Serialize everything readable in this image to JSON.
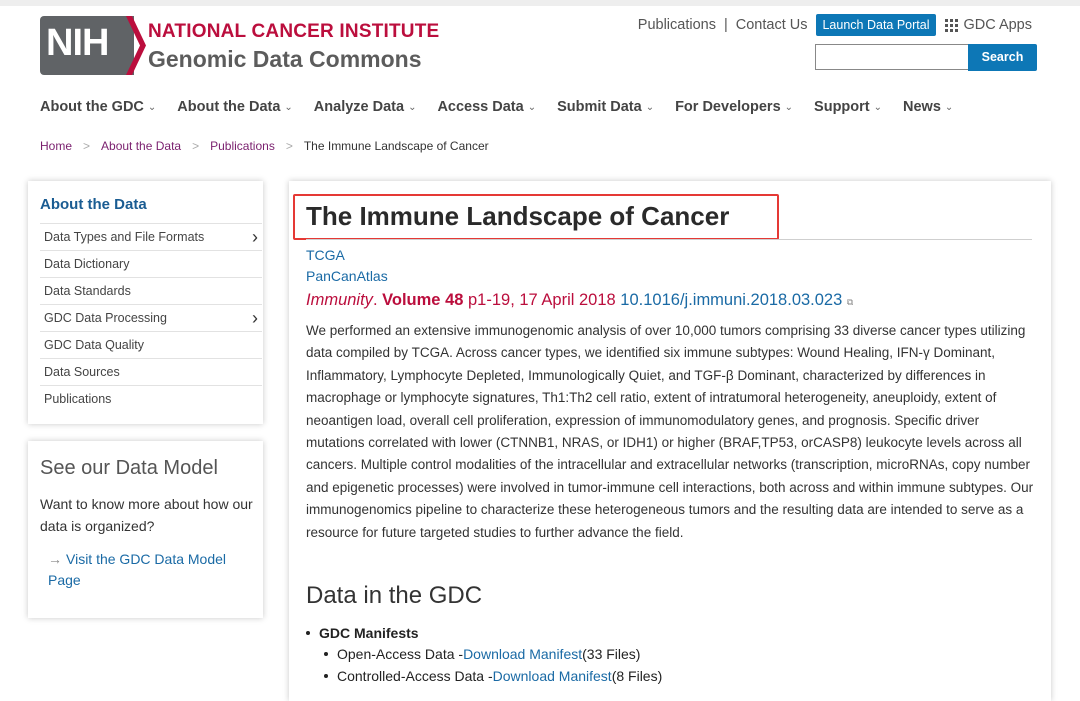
{
  "header": {
    "logo_mark": "NIH",
    "institute": "NATIONAL CANCER INSTITUTE",
    "site_name": "Genomic Data Commons",
    "util_links": [
      "Publications",
      "Contact Us"
    ],
    "util_separator": "|",
    "portal_button": "Launch Data Portal",
    "apps_label": "GDC Apps",
    "search_button": "Search",
    "search_value": ""
  },
  "nav": {
    "items": [
      "About the GDC",
      "About the Data",
      "Analyze Data",
      "Access Data",
      "Submit Data",
      "For Developers",
      "Support",
      "News"
    ],
    "chevron": "⌄"
  },
  "breadcrumb": {
    "items": [
      "Home",
      "About the Data",
      "Publications"
    ],
    "current": "The Immune Landscape of Cancer",
    "separator": ">"
  },
  "sidebar": {
    "title": "About the Data",
    "items": [
      {
        "label": "Data Types and File Formats",
        "expandable": true
      },
      {
        "label": "Data Dictionary",
        "expandable": false
      },
      {
        "label": "Data Standards",
        "expandable": false
      },
      {
        "label": "GDC Data Processing",
        "expandable": true
      },
      {
        "label": "GDC Data Quality",
        "expandable": false
      },
      {
        "label": "Data Sources",
        "expandable": false
      },
      {
        "label": "Publications",
        "expandable": false
      }
    ],
    "arrow": "›"
  },
  "data_model": {
    "title": "See our Data Model",
    "description": "Want to know more about how our data is organized?",
    "link_arrow": "→",
    "link": "Visit the GDC Data Model Page"
  },
  "article": {
    "title": "The Immune Landscape of Cancer",
    "tags": [
      "TCGA",
      "PanCanAtlas"
    ],
    "journal": "Immunity",
    "journal_sep": ". ",
    "volume": "Volume 48",
    "pages_date": " p1-19, 17 April 2018 ",
    "doi": "10.1016/j.immuni.2018.03.023",
    "external_icon": "⧉",
    "abstract": "We performed an extensive immunogenomic analysis of over 10,000 tumors comprising 33 diverse cancer types utilizing data compiled by TCGA. Across cancer types, we identified six immune subtypes: Wound Healing, IFN-γ Dominant, Inflammatory, Lymphocyte Depleted, Immunologically Quiet, and TGF-β Dominant, characterized by differences in macrophage or lymphocyte signatures, Th1:Th2 cell ratio, extent of intratumoral heterogeneity, aneuploidy, extent of neoantigen load, overall cell proliferation, expression of immunomodulatory genes, and prognosis. Specific driver mutations correlated with lower (CTNNB1, NRAS, or IDH1) or higher (BRAF,TP53, orCASP8) leukocyte levels across all cancers. Multiple control modalities of the intracellular and extracellular networks (transcription, microRNAs, copy number and epigenetic processes) were involved in tumor-immune cell interactions, both across and within immune subtypes. Our immunogenomics pipeline to characterize these heterogeneous tumors and the resulting data are intended to serve as a resource for future targeted studies to further advance the field.",
    "section_title": "Data in the GDC",
    "manifest_heading": "GDC Manifests",
    "manifests": [
      {
        "prefix": "Open-Access Data - ",
        "link": "Download Manifest",
        "suffix": " (33 Files)"
      },
      {
        "prefix": "Controlled-Access Data - ",
        "link": "Download Manifest",
        "suffix": " (8 Files)"
      }
    ]
  },
  "colors": {
    "nci_red": "#bb0e3d",
    "link_blue": "#1a6aa5",
    "button_blue": "#0d77b6",
    "breadcrumb_purple": "#7a1f6e",
    "highlight_red": "#e53935"
  }
}
